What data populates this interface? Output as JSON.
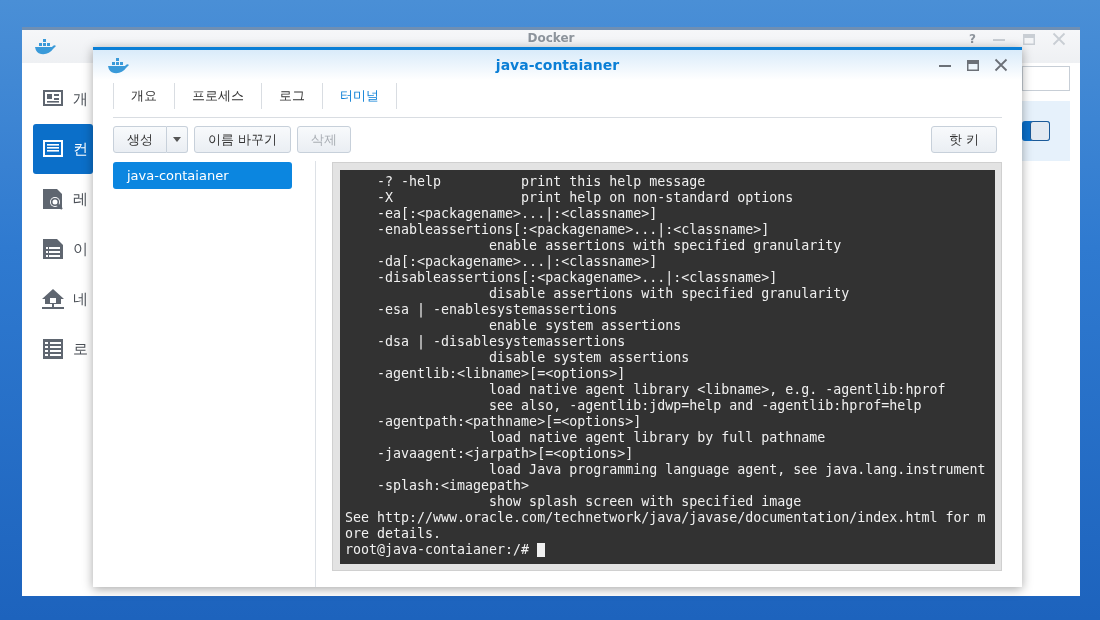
{
  "background_window": {
    "title": "Docker",
    "controls": [
      {
        "kind": "help",
        "label": "?"
      },
      {
        "kind": "minimize"
      },
      {
        "kind": "maximize"
      },
      {
        "kind": "close"
      }
    ],
    "sidebar": {
      "items": [
        {
          "label": "개",
          "selected": false
        },
        {
          "label": "컨",
          "selected": true
        },
        {
          "label": "레",
          "selected": false
        },
        {
          "label": "이",
          "selected": false
        },
        {
          "label": "네",
          "selected": false
        },
        {
          "label": "로",
          "selected": false
        }
      ]
    },
    "toggle": {
      "on": true
    }
  },
  "window": {
    "title": "java-contaianer",
    "controls": [
      {
        "kind": "minimize"
      },
      {
        "kind": "maximize"
      },
      {
        "kind": "close"
      }
    ],
    "tabs": [
      {
        "label": "개요",
        "selected": false
      },
      {
        "label": "프로세스",
        "selected": false
      },
      {
        "label": "로그",
        "selected": false
      },
      {
        "label": "터미널",
        "selected": true
      }
    ],
    "toolbar": [
      {
        "label": "생성",
        "kind": "split",
        "disabled": false
      },
      {
        "label": "이름 바꾸기",
        "kind": "plain",
        "disabled": false
      },
      {
        "label": "삭제",
        "kind": "plain",
        "disabled": true
      }
    ],
    "hotkey_button": "핫 키",
    "containers": [
      {
        "label": "java-contaianer",
        "selected": true
      }
    ],
    "terminal": {
      "lines": [
        "    -? -help          print this help message",
        "    -X                print help on non-standard options",
        "    -ea[:<packagename>...|:<classname>]",
        "    -enableassertions[:<packagename>...|:<classname>]",
        "                  enable assertions with specified granularity",
        "    -da[:<packagename>...|:<classname>]",
        "    -disableassertions[:<packagename>...|:<classname>]",
        "                  disable assertions with specified granularity",
        "    -esa | -enablesystemassertions",
        "                  enable system assertions",
        "    -dsa | -disablesystemassertions",
        "                  disable system assertions",
        "    -agentlib:<libname>[=<options>]",
        "                  load native agent library <libname>, e.g. -agentlib:hprof",
        "                  see also, -agentlib:jdwp=help and -agentlib:hprof=help",
        "    -agentpath:<pathname>[=<options>]",
        "                  load native agent library by full pathname",
        "    -javaagent:<jarpath>[=<options>]",
        "                  load Java programming language agent, see java.lang.instrument",
        "    -splash:<imagepath>",
        "                  show splash screen with specified image",
        "See http://www.oracle.com/technetwork/java/javase/documentation/index.html for m",
        "ore details."
      ],
      "prompt": "root@java-contaianer:/# "
    }
  }
}
